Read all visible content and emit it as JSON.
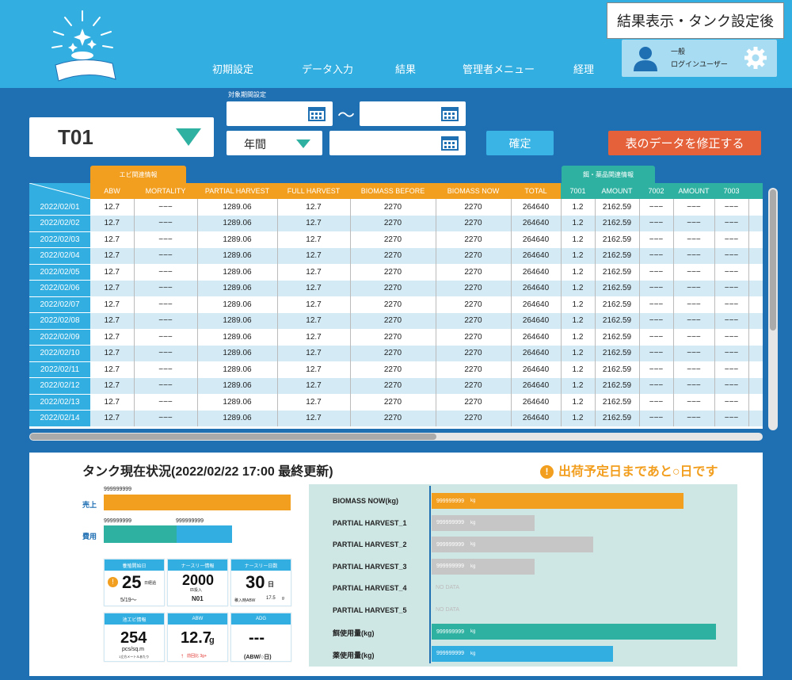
{
  "header": {
    "screen_title": "結果表示・タンク設定後",
    "nav": [
      "初期設定",
      "データ入力",
      "結果",
      "管理者メニュー",
      "経理"
    ],
    "user": {
      "role": "一般",
      "name": "ログインユーザー"
    }
  },
  "filters": {
    "tank": "T01",
    "period_label": "対象期間設定",
    "tilde": "〜",
    "period_type": "年間",
    "confirm_label": "確定",
    "edit_label": "表のデータを修正する"
  },
  "table": {
    "group_shrimp": "エビ関連情報",
    "group_feed": "餌・薬品関連情報",
    "columns": [
      "ABW",
      "MORTALITY",
      "PARTIAL HARVEST",
      "FULL HARVEST",
      "BIOMASS BEFORE",
      "BIOMASS NOW",
      "TOTAL",
      "7001",
      "AMOUNT",
      "7002",
      "AMOUNT",
      "7003"
    ],
    "rows": [
      {
        "date": "2022/02/01",
        "cells": [
          "12.7",
          "−−−",
          "1289.06",
          "12.7",
          "2270",
          "2270",
          "264640",
          "1.2",
          "2162.59",
          "−−−",
          "−−−",
          "−−−"
        ]
      },
      {
        "date": "2022/02/02",
        "cells": [
          "12.7",
          "−−−",
          "1289.06",
          "12.7",
          "2270",
          "2270",
          "264640",
          "1.2",
          "2162.59",
          "−−−",
          "−−−",
          "−−−"
        ]
      },
      {
        "date": "2022/02/03",
        "cells": [
          "12.7",
          "−−−",
          "1289.06",
          "12.7",
          "2270",
          "2270",
          "264640",
          "1.2",
          "2162.59",
          "−−−",
          "−−−",
          "−−−"
        ]
      },
      {
        "date": "2022/02/04",
        "cells": [
          "12.7",
          "−−−",
          "1289.06",
          "12.7",
          "2270",
          "2270",
          "264640",
          "1.2",
          "2162.59",
          "−−−",
          "−−−",
          "−−−"
        ]
      },
      {
        "date": "2022/02/05",
        "cells": [
          "12.7",
          "−−−",
          "1289.06",
          "12.7",
          "2270",
          "2270",
          "264640",
          "1.2",
          "2162.59",
          "−−−",
          "−−−",
          "−−−"
        ]
      },
      {
        "date": "2022/02/06",
        "cells": [
          "12.7",
          "−−−",
          "1289.06",
          "12.7",
          "2270",
          "2270",
          "264640",
          "1.2",
          "2162.59",
          "−−−",
          "−−−",
          "−−−"
        ]
      },
      {
        "date": "2022/02/07",
        "cells": [
          "12.7",
          "−−−",
          "1289.06",
          "12.7",
          "2270",
          "2270",
          "264640",
          "1.2",
          "2162.59",
          "−−−",
          "−−−",
          "−−−"
        ]
      },
      {
        "date": "2022/02/08",
        "cells": [
          "12.7",
          "−−−",
          "1289.06",
          "12.7",
          "2270",
          "2270",
          "264640",
          "1.2",
          "2162.59",
          "−−−",
          "−−−",
          "−−−"
        ]
      },
      {
        "date": "2022/02/09",
        "cells": [
          "12.7",
          "−−−",
          "1289.06",
          "12.7",
          "2270",
          "2270",
          "264640",
          "1.2",
          "2162.59",
          "−−−",
          "−−−",
          "−−−"
        ]
      },
      {
        "date": "2022/02/10",
        "cells": [
          "12.7",
          "−−−",
          "1289.06",
          "12.7",
          "2270",
          "2270",
          "264640",
          "1.2",
          "2162.59",
          "−−−",
          "−−−",
          "−−−"
        ]
      },
      {
        "date": "2022/02/11",
        "cells": [
          "12.7",
          "−−−",
          "1289.06",
          "12.7",
          "2270",
          "2270",
          "264640",
          "1.2",
          "2162.59",
          "−−−",
          "−−−",
          "−−−"
        ]
      },
      {
        "date": "2022/02/12",
        "cells": [
          "12.7",
          "−−−",
          "1289.06",
          "12.7",
          "2270",
          "2270",
          "264640",
          "1.2",
          "2162.59",
          "−−−",
          "−−−",
          "−−−"
        ]
      },
      {
        "date": "2022/02/13",
        "cells": [
          "12.7",
          "−−−",
          "1289.06",
          "12.7",
          "2270",
          "2270",
          "264640",
          "1.2",
          "2162.59",
          "−−−",
          "−−−",
          "−−−"
        ]
      },
      {
        "date": "2022/02/14",
        "cells": [
          "12.7",
          "−−−",
          "1289.06",
          "12.7",
          "2270",
          "2270",
          "264640",
          "1.2",
          "2162.59",
          "−−−",
          "−−−",
          "−−−"
        ]
      }
    ]
  },
  "status": {
    "title": "タンク現在状況(2022/02/22 17:00 最終更新)",
    "notice": "出荷予定日まであと○日です",
    "sales_label": "売上",
    "sales_value": "999999999",
    "cost_label": "費用",
    "cost_value_a": "999999999",
    "cost_value_b": "999999999",
    "cards": {
      "start": {
        "title": "養殖開始日",
        "value": "25",
        "unit": "日経過",
        "sub": "5/19〜"
      },
      "nursery": {
        "title": "ナースリー情報",
        "value": "2000",
        "unit": "匹投入",
        "sub": "N01"
      },
      "nursery_days": {
        "title": "ナースリー日数",
        "value": "30",
        "unit": "日",
        "sub": "稚入時ABW",
        "sub2": "17.5",
        "sub3": "g"
      },
      "shrimp": {
        "title": "池エビ情報",
        "value": "254",
        "unit": "pcs/sq.m",
        "sub": "1立方メートルあたり"
      },
      "abw": {
        "title": "ABW",
        "value": "12.7",
        "unit": "g",
        "sub": "前回比 3g+"
      },
      "adg": {
        "title": "ADG",
        "value": "---",
        "sub": "(ABW/○日)"
      }
    },
    "bars": [
      {
        "label": "BIOMASS NOW(kg)",
        "value": "999999999",
        "unit": "kg",
        "level": 0.86,
        "color": "#f29e1e"
      },
      {
        "label": "PARTIAL HARVEST_1",
        "value": "999999999",
        "unit": "kg",
        "level": 0.35,
        "color": "#c6c6c6"
      },
      {
        "label": "PARTIAL HARVEST_2",
        "value": "999999999",
        "unit": "kg",
        "level": 0.55,
        "color": "#c6c6c6"
      },
      {
        "label": "PARTIAL HARVEST_3",
        "value": "999999999",
        "unit": "kg",
        "level": 0.35,
        "color": "#c6c6c6"
      },
      {
        "label": "PARTIAL HARVEST_4",
        "value": "NO DATA",
        "level": 0,
        "color": ""
      },
      {
        "label": "PARTIAL HARVEST_5",
        "value": "NO DATA",
        "level": 0,
        "color": ""
      },
      {
        "label": "餌使用量(kg)",
        "value": "999999999",
        "unit": "kg",
        "level": 0.97,
        "color": "#2fb1a1"
      },
      {
        "label": "薬使用量(kg)",
        "value": "999999999",
        "unit": "kg",
        "level": 0.62,
        "color": "#32aee0"
      }
    ]
  }
}
